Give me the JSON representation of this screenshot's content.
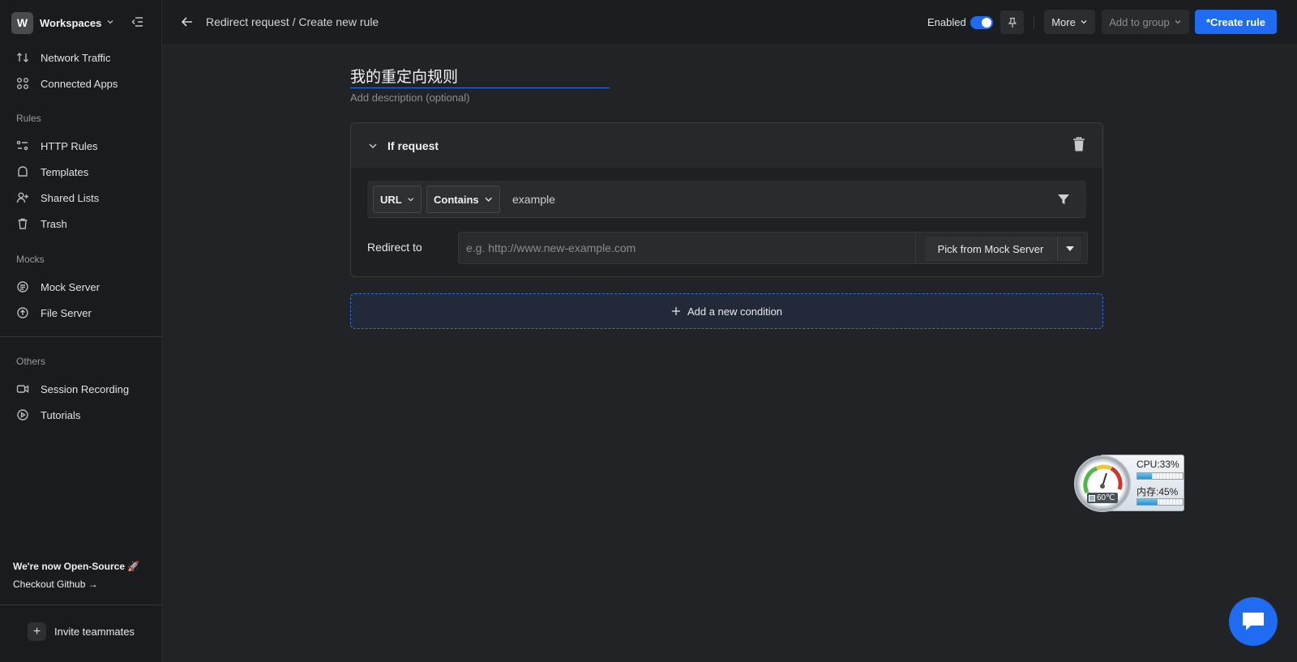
{
  "workspace": {
    "initial": "W",
    "label": "Workspaces"
  },
  "sidebar": {
    "top_items": [
      {
        "label": "Network Traffic",
        "icon": "arrows-up-down-icon"
      },
      {
        "label": "Connected Apps",
        "icon": "apps-grid-icon"
      }
    ],
    "sections": [
      {
        "title": "Rules",
        "items": [
          {
            "label": "HTTP Rules",
            "icon": "rules-icon"
          },
          {
            "label": "Templates",
            "icon": "templates-icon"
          },
          {
            "label": "Shared Lists",
            "icon": "user-plus-icon"
          },
          {
            "label": "Trash",
            "icon": "trash-icon"
          }
        ]
      },
      {
        "title": "Mocks",
        "items": [
          {
            "label": "Mock Server",
            "icon": "mock-server-icon"
          },
          {
            "label": "File Server",
            "icon": "upload-icon"
          }
        ]
      },
      {
        "title": "Others",
        "items": [
          {
            "label": "Session Recording",
            "icon": "video-icon"
          },
          {
            "label": "Tutorials",
            "icon": "play-icon"
          }
        ]
      }
    ],
    "open_source_title": "We're now Open-Source 🚀",
    "github_link": "Checkout Github →",
    "invite_label": "Invite teammates"
  },
  "topbar": {
    "breadcrumb": "Redirect request / Create new rule",
    "enabled_label": "Enabled",
    "enabled": true,
    "more_label": "More",
    "add_to_group_label": "Add to group",
    "create_label": "*Create rule"
  },
  "rule": {
    "name": "我的重定向规则",
    "description_placeholder": "Add description (optional)",
    "condition_title": "If request",
    "match_field": "URL",
    "match_operator": "Contains",
    "match_value": "example",
    "redirect_label": "Redirect to",
    "redirect_placeholder": "e.g. http://www.new-example.com",
    "pick_mock_label": "Pick from Mock Server",
    "add_condition_label": "Add a new condition"
  },
  "monitor": {
    "cpu_label": "CPU:33%",
    "cpu": 0.33,
    "mem_label": "内存:45%",
    "mem": 0.45,
    "temp_label": "60℃"
  },
  "colors": {
    "accent": "#1f6cf2",
    "sidebar_bg": "#1a1b1e",
    "main_bg": "#222326"
  }
}
